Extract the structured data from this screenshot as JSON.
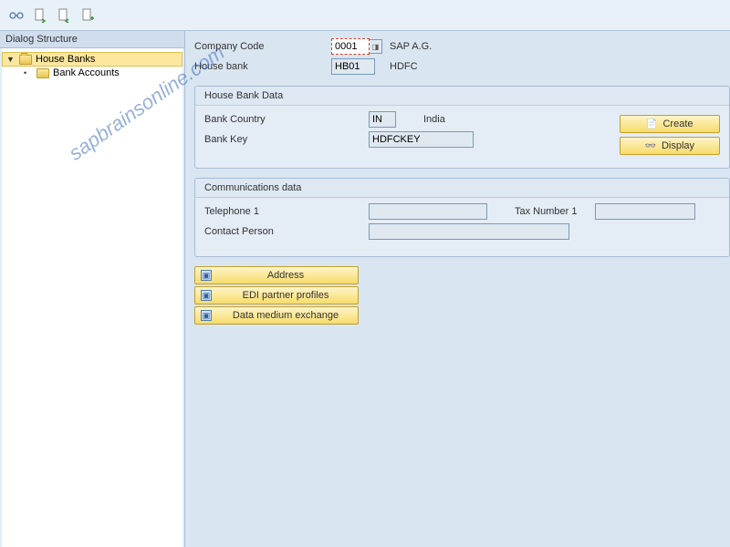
{
  "watermark": "sapbrainsonline.com",
  "dialog_structure": {
    "title": "Dialog Structure",
    "items": [
      {
        "label": "House Banks",
        "expanded": true,
        "active": true
      },
      {
        "label": "Bank Accounts",
        "child": true
      }
    ]
  },
  "header": {
    "company_code": {
      "label": "Company Code",
      "value": "0001",
      "desc": "SAP A.G."
    },
    "house_bank": {
      "label": "House bank",
      "value": "HB01",
      "desc": "HDFC"
    }
  },
  "house_bank_data": {
    "title": "House Bank Data",
    "bank_country": {
      "label": "Bank Country",
      "value": "IN",
      "desc": "India"
    },
    "bank_key": {
      "label": "Bank Key",
      "value": "HDFCKEY"
    },
    "buttons": {
      "create": "Create",
      "display": "Display"
    }
  },
  "communications": {
    "title": "Communications data",
    "telephone1": {
      "label": "Telephone 1",
      "value": ""
    },
    "tax_number1": {
      "label": "Tax Number 1",
      "value": ""
    },
    "contact_person": {
      "label": "Contact Person",
      "value": ""
    }
  },
  "action_buttons": {
    "address": "Address",
    "edi": "EDI partner profiles",
    "dme": "Data medium exchange"
  }
}
